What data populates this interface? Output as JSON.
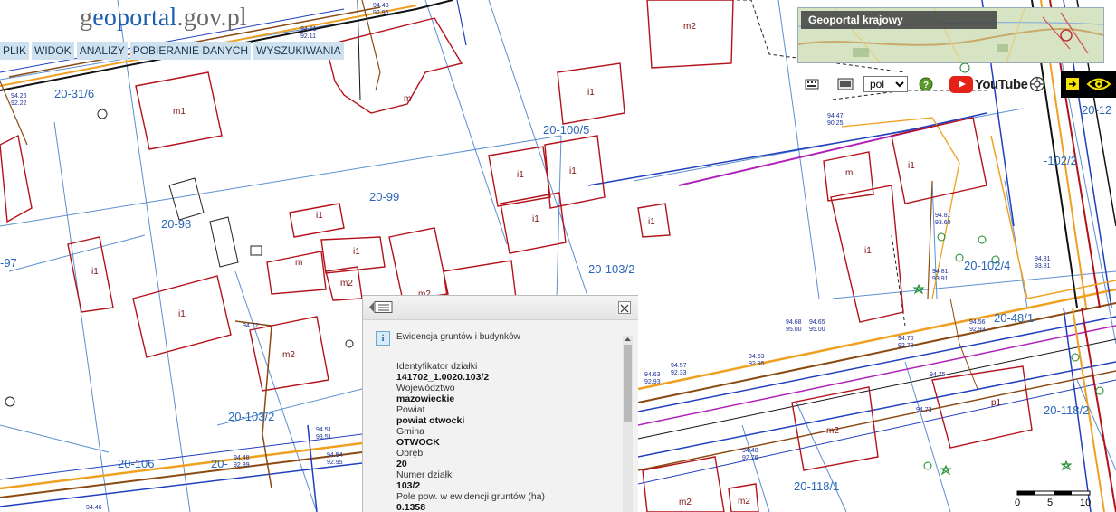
{
  "logo": {
    "part1": "g",
    "part2": "eoportal",
    "part3": ".gov.pl"
  },
  "menu": [
    {
      "label": "PLIK"
    },
    {
      "label": "WIDOK"
    },
    {
      "label": "ANALIZY"
    },
    {
      "label": "POBIERANIE DANYCH"
    },
    {
      "label": "WYSZUKIWANIA"
    }
  ],
  "overview": {
    "title": "Geoportal krajowy"
  },
  "toolbar": {
    "language": "pol",
    "language_options": [
      "pol"
    ],
    "youtube_label": "YouTube",
    "colors": {
      "youtube": "#e52218",
      "accessibility_bg": "#000000",
      "accessibility_accent": "#f5e400"
    },
    "icons": [
      "keyboard-icon",
      "grid-icon",
      "help-icon",
      "youtube-icon",
      "settings-icon",
      "arrow-icon",
      "eye-icon"
    ]
  },
  "map": {
    "parcel_labels": [
      "20-31/6",
      "20-100/5",
      "20-99",
      "20-98",
      "-97",
      "20-103/2",
      "20-102/4",
      "20-48/1",
      "20-103/2",
      "20-106",
      "20-",
      "20-118/2",
      "20-118/1",
      "-102/2",
      "20-12"
    ],
    "building_labels": [
      "m2",
      "m1",
      "m",
      "i1",
      "i1",
      "i1",
      "i1",
      "i1",
      "i1",
      "i1",
      "i1",
      "m2",
      "m2",
      "m2",
      "p1",
      "m",
      "i1",
      "i1",
      "m2",
      "m2",
      "m2",
      "m",
      "i1"
    ],
    "elevation_labels": [
      "94.48",
      "92.96",
      "94.26",
      "92.22",
      "94.47",
      "90.25",
      "94.81",
      "93.60",
      "94.81",
      "93.91",
      "94.81",
      "93.81",
      "94.68",
      "95.00",
      "94.65",
      "95.00",
      "94.56",
      "92.93",
      "94.63",
      "92.93",
      "94.57",
      "92.33",
      "94.51",
      "93.51",
      "94.54",
      "92.95",
      "94.48",
      "92.89",
      "94.40",
      "92.76",
      "94.75",
      "94.73",
      "94.70",
      "92.78",
      "94.72",
      "94.46",
      "94.63",
      "92.95",
      "94.61",
      "92.11"
    ],
    "colors": {
      "parcel_line": "#2a66b8",
      "building": "#b3121a",
      "utility_orange": "#f0a020",
      "utility_brown": "#8b4a12",
      "utility_blue": "#1f3fbf",
      "utility_magenta": "#b020b8",
      "utility_black": "#111111"
    }
  },
  "popup": {
    "title": "Ewidencja gruntów i budynków",
    "fields": [
      {
        "label": "Identyfikator działki",
        "value": "141702_1.0020.103/2"
      },
      {
        "label": "Województwo",
        "value": "mazowieckie"
      },
      {
        "label": "Powiat",
        "value": "powiat otwocki"
      },
      {
        "label": "Gmina",
        "value": "OTWOCK"
      },
      {
        "label": "Obręb",
        "value": "20"
      },
      {
        "label": "Numer działki",
        "value": "103/2"
      },
      {
        "label": "Pole pow. w ewidencji gruntów (ha)",
        "value": "0.1358"
      }
    ]
  },
  "scale": {
    "labels": [
      "0",
      "5",
      "10"
    ]
  }
}
